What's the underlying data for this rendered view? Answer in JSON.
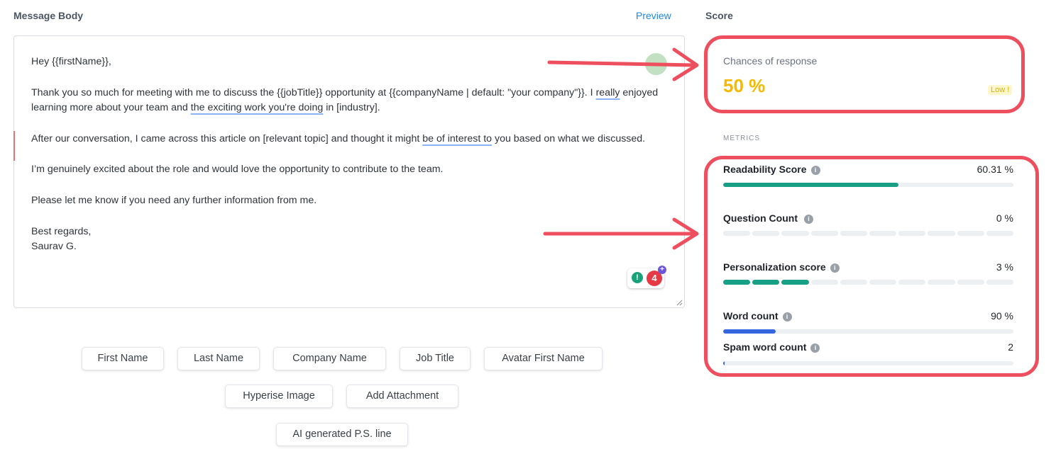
{
  "header": {
    "message_body_label": "Message Body",
    "preview_label": "Preview",
    "score_label": "Score"
  },
  "editor": {
    "greeting": "Hey {{firstName}},",
    "p1_a": "Thank you so much for meeting with me to discuss the {{jobTitle}} opportunity at {{companyName | default: \"your company\"}}. I ",
    "p1_u1": "really",
    "p1_b": " enjoyed learning more about your team and ",
    "p1_u2": "the exciting work you're doing",
    "p1_c": " in [industry].",
    "p2_a": "After our conversation, I came across this article on [relevant topic] and thought it might ",
    "p2_u1": "be of interest to",
    "p2_b": " you based on what we discussed.",
    "p3": "I’m genuinely excited about the role and would love the opportunity to contribute to the team.",
    "p4": "Please let me know if you need any further information from me.",
    "closing": "Best regards,",
    "signature": "Saurav G.",
    "grammar_count": "4"
  },
  "chips": {
    "first_name": "First Name",
    "last_name": "Last Name",
    "company_name": "Company Name",
    "job_title": "Job Title",
    "avatar_first_name": "Avatar First Name",
    "hyperise_image": "Hyperise Image",
    "add_attachment": "Add Attachment",
    "ai_ps_line": "AI generated P.S. line"
  },
  "score": {
    "label": "Chances of response",
    "value": "50 %",
    "badge": "Low !",
    "badge_color": "#f6b800"
  },
  "metrics": {
    "heading": "METRICS",
    "readability": {
      "name": "Readability Score",
      "value": "60.31 %",
      "fill": 0.6031,
      "color": "#17a085"
    },
    "questions": {
      "name": "Question Count",
      "value": "0 %",
      "segments_on": 0,
      "segments_total": 10
    },
    "personalization": {
      "name": "Personalization score",
      "value": "3 %",
      "segments_on": 3,
      "segments_total": 10,
      "color": "#17a085"
    },
    "word_count": {
      "name": "Word count",
      "value": "90 %",
      "fill": 0.18,
      "color": "#3566e0"
    },
    "spam": {
      "name": "Spam word count",
      "value": "2",
      "fill": 0.005,
      "color": "#3566e0"
    }
  },
  "annotation_color": "#ee4f5f"
}
